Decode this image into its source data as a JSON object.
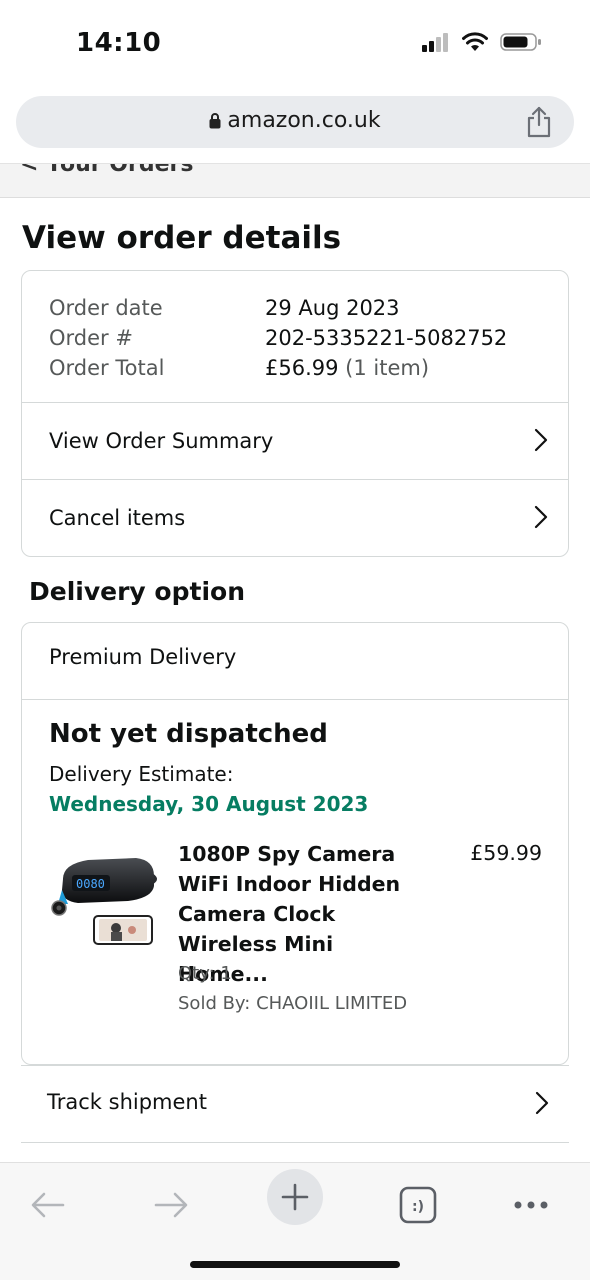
{
  "status_bar": {
    "time": "14:10"
  },
  "browser": {
    "url": "amazon.co.uk"
  },
  "back_header": {
    "label": "< Your Orders"
  },
  "page_title": "View order details",
  "order": {
    "date_label": "Order date",
    "date_value": "29 Aug 2023",
    "number_label": "Order #",
    "number_value": "202-5335221-5082752",
    "total_label": "Order Total",
    "total_value": "£56.99",
    "total_items": "(1 item)",
    "rows": [
      "View Order Summary",
      "Cancel items"
    ]
  },
  "delivery": {
    "heading": "Delivery option",
    "option": "Premium Delivery",
    "status": "Not yet dispatched",
    "estimate_label": "Delivery Estimate:",
    "estimate_date": "Wednesday, 30 August 2023",
    "estimate_color": "#067d62"
  },
  "product": {
    "title": "1080P Spy Camera WiFi Indoor Hidden Camera Clock Wireless Mini Home...",
    "price": "£59.99",
    "qty": "Qty: 1",
    "seller": "Sold By: CHAOIIL LIMITED",
    "clock_display": "0080"
  },
  "track": {
    "label": "Track shipment"
  },
  "toolbar": {
    "icons": [
      "back-arrow-icon",
      "forward-arrow-icon",
      "plus-icon",
      "tabs-icon",
      "more-icon"
    ],
    "tabs_label": ":)"
  }
}
